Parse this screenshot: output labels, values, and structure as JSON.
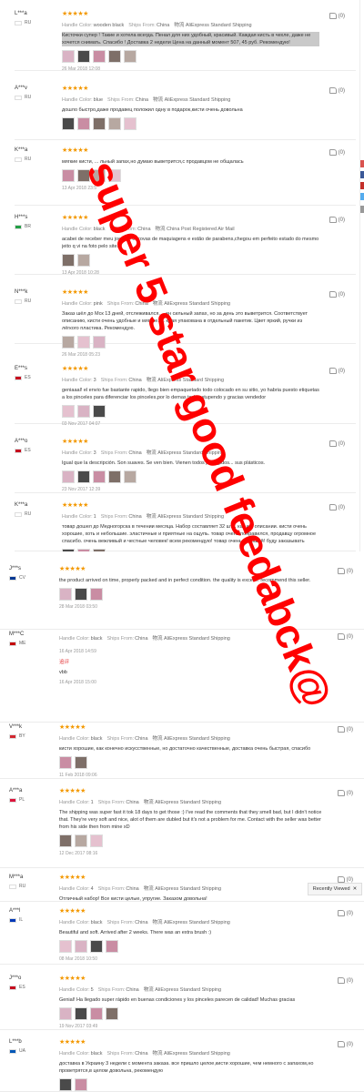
{
  "labels": {
    "handle_color": "Handle Color:",
    "ships_from": "Ships From:",
    "recently_viewed": "Recently Viewed"
  },
  "colors": {
    "stars": "#f39800",
    "watermark": "#ff0000",
    "accent": "#e4393c"
  },
  "watermark_text": "super 5 star good feedabck@",
  "top_reviews": [
    {
      "user": "L***a",
      "country": "RU",
      "stars": "★★★★★",
      "color": "wooden black",
      "ships": "China",
      "shipping": "物流 AliExpress Standard Shipping",
      "text": "Кисточки супер ! Такие и хотела всегда. Пенал для них удобный, красивый. Каждая кисть в чехле, даже не хочется снимать. Спасибо ! Доставка 2 недели Цена на данный момент 507, 45 руб. Рекомендую!",
      "date": "26 Mar 2018 12:08",
      "likes": "(0)",
      "thumbs": 5,
      "highlight": true
    },
    {
      "user": "A***v",
      "country": "RU",
      "stars": "★★★★★",
      "color": "blue",
      "ships": "China",
      "shipping": "物流 AliExpress Standard Shipping",
      "text": "дошло быстро,даже продавец положил одну в подарок,кисти очень довольна",
      "date": "",
      "likes": "(0)",
      "thumbs": 5
    },
    {
      "user": "K***a",
      "country": "RU",
      "stars": "★★★★★",
      "color": "",
      "ships": "",
      "shipping": "",
      "text": "мягкие кисти, ... льный запах,но думаю выветрится,с продавцом не общалась",
      "date": "13 Apr 2018 23:5",
      "likes": "(0)",
      "thumbs": 4
    },
    {
      "user": "H***s",
      "country": "BR",
      "stars": "★★★★★",
      "color": "black",
      "ships": "China",
      "shipping": "物流 China Post Registered Air Mail",
      "text": "acabei de receber meu jogo de escovas de maquiagens e estão de parabens,chegou em perfeito estado do mesmo jeito q vi na foto pelo site.",
      "date": "13 Apr 2018 10:28",
      "likes": "(0)",
      "thumbs": 2
    },
    {
      "user": "N***k",
      "country": "RU",
      "stars": "★★★★★",
      "color": "pink",
      "ships": "China",
      "shipping": "物流 AliExpress Standard Shipping",
      "text": "Заказ шёл до Мск 13 дней, отслеживался. ...ен сильный запах, но за день это выветрится. Соответствует описанию, кисти очень удобные и мягкие. ... кдая упакована в отдельный пакетик. Цвет яркий, ручки из лёгкого пластика. Рекомендую.",
      "date": "26 Mar 2018 05:23",
      "likes": "(0)",
      "thumbs": 3
    },
    {
      "user": "E***s",
      "country": "ES",
      "stars": "★★★★★",
      "color": "3",
      "ships": "China",
      "shipping": "物流 AliExpress Standard Shipping",
      "text": "geniaaal! el envio fue bastante rapido, llego bien empaquetado todo colocado en su sitio, yo habria puesto etiquetas a los pinceles para diferenciar los pinceles,por lo demas todo estupendo y gracias vendedor",
      "date": "03 Nov 2017 04:07",
      "likes": "(0)",
      "thumbs": 3
    },
    {
      "user": "A***o",
      "country": "ES",
      "stars": "★★★★★",
      "color": "3",
      "ships": "China",
      "shipping": "物流 AliExpress Standard Shipping",
      "text": "Igual que la descripción. Son suaves. Se ven bien. Vienen todos protegidos... sus plásticos.",
      "date": "23 Nov 2017 12:39",
      "likes": "(0)",
      "thumbs": 5
    },
    {
      "user": "K***a",
      "country": "RU",
      "stars": "★★★★★",
      "color": "1",
      "ships": "China",
      "shipping": "物流 AliExpress Standard Shipping",
      "text": "товар дошел до Медногорска в течении месяца. Набор составляет 32 шт... как и в описании. кисти очень хорошие, хоть и небольшие. эластичные и приятные на ощупь. товар очень понравился, продавцу огромное спасибо. очень вежливый и честные человек! всем рекомендую! товар очень хороший! буду заказывать еще))))",
      "date": "16 Nov 2017 21:44",
      "likes": "(0)",
      "thumbs": 3
    }
  ],
  "bottom_reviews": [
    {
      "user": "J***s",
      "country": "CV",
      "stars": "★★★★★",
      "color": "",
      "ships": "",
      "shipping": "",
      "text": "the product arrived on time, properly packed and in perfect condition. the quality is excell... recommend this seller.",
      "date": "28 Mar 2018 03:50",
      "likes": "(0)",
      "thumbs": 3
    },
    {
      "user": "M***C",
      "country": "ME",
      "stars": "",
      "color": "black",
      "ships": "China",
      "shipping": "物流 AliExpress Standard Shipping",
      "text": "",
      "date": "16 Apr 2018 14:59",
      "likes": "(0)",
      "thumbs": 0,
      "reply_label": "追评",
      "reply": "vbb",
      "reply_date": "16 Apr 2018 15:00"
    },
    {
      "user": "V***k",
      "country": "BY",
      "stars": "★★★★★",
      "color": "black",
      "ships": "China",
      "shipping": "物流 AliExpress Standard Shipping",
      "text": "кисти хорошие, как конечно искусственные, но достаточно качественные, доставка очень быстрая, спасибо",
      "date": "11 Feb 2018 09:06",
      "likes": "(0)",
      "thumbs": 2
    },
    {
      "user": "A***a",
      "country": "PL",
      "stars": "★★★★★",
      "color": "1",
      "ships": "China",
      "shipping": "物流 AliExpress Standard Shipping",
      "text": "The shipping was super fast it tok 18 days to get those :) I've read the comments that they smell bad, but I didn't notice that. They're very soft and nice, alot of them are dubled but it's not a problem for me. Contact with the seller was better from his side then from mine xD",
      "date": "12 Dec 2017 08:16",
      "likes": "(0)",
      "thumbs": 3
    },
    {
      "user": "M***a",
      "country": "RU",
      "stars": "★★★★★",
      "color": "4",
      "ships": "China",
      "shipping": "物流 AliExpress Standard Shipping",
      "text": "Отличный набор! Все кисти целые, упругие. Заказом довольна!",
      "date": "",
      "likes": "(0)",
      "thumbs": 0
    },
    {
      "user": "A***l",
      "country": "IL",
      "stars": "★★★★★",
      "color": "black",
      "ships": "China",
      "shipping": "物流 AliExpress Standard Shipping",
      "text": "Beautiful and soft. Arrived after 2 weeks. There was an extra brush :)",
      "date": "08 Mar 2018 10:50",
      "likes": "(0)",
      "thumbs": 4
    },
    {
      "user": "J***o",
      "country": "ES",
      "stars": "★★★★★",
      "color": "5",
      "ships": "China",
      "shipping": "物流 AliExpress Standard Shipping",
      "text": "Genial! Ha llegado super rápido en buenas condiciones y los pinceles parecen de calidad! Muchas gracias",
      "date": "19 Nov 2017 03:49",
      "likes": "(0)",
      "thumbs": 4
    },
    {
      "user": "L***b",
      "country": "UA",
      "stars": "★★★★★",
      "color": "black",
      "ships": "China",
      "shipping": "物流 AliExpress Standard Shipping",
      "text": "доставка в Украину 3 недели с момента заказа. все пришло целое,кисти хорошие, чем немного с запахом,но проветрятся,в целом довольна, рекомендую",
      "date": "",
      "likes": "(0)",
      "thumbs": 2
    }
  ]
}
